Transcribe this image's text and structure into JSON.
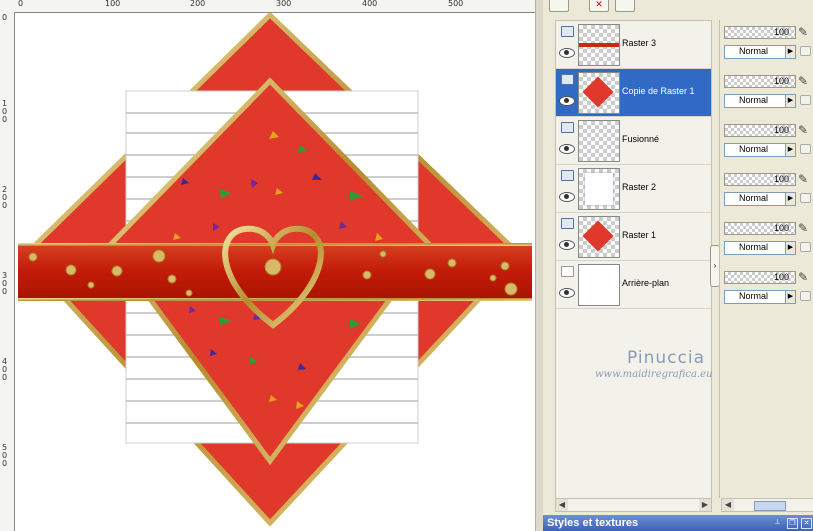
{
  "rulers": {
    "top_ticks": [
      "0",
      "100",
      "200",
      "300",
      "400",
      "500"
    ],
    "left_ticks": [
      "0",
      "100",
      "200",
      "300",
      "400",
      "500"
    ]
  },
  "layers": [
    {
      "name": "Raster 3",
      "thumb": "strip",
      "selected": false
    },
    {
      "name": "Copie de Raster 1",
      "thumb": "diamond",
      "selected": true
    },
    {
      "name": "Fusionné",
      "thumb": "transparent",
      "selected": false
    },
    {
      "name": "Raster 2",
      "thumb": "white-square",
      "selected": false
    },
    {
      "name": "Raster 1",
      "thumb": "diamond",
      "selected": false
    },
    {
      "name": "Arrière-plan",
      "thumb": "white",
      "selected": false
    }
  ],
  "opacity": [
    {
      "value": "100",
      "blend": "Normal"
    },
    {
      "value": "100",
      "blend": "Normal"
    },
    {
      "value": "100",
      "blend": "Normal"
    },
    {
      "value": "100",
      "blend": "Normal"
    },
    {
      "value": "100",
      "blend": "Normal"
    },
    {
      "value": "100",
      "blend": "Normal"
    }
  ],
  "watermark": {
    "name": "Pinuccia",
    "url": "www.maidiregrafica.eu"
  },
  "styles_panel": {
    "title": "Styles et textures"
  },
  "colors": {
    "red": "#e0392c",
    "band": "#c81e0c",
    "gold": "#c9a84a",
    "selection": "#316ac5"
  }
}
